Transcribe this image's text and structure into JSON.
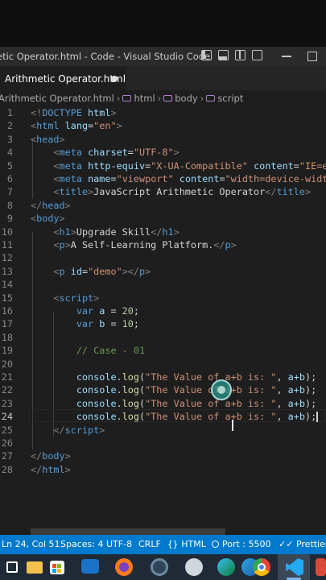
{
  "window": {
    "title": "etic Operator.html - Code - Visual Studio Code"
  },
  "tab": {
    "label": "Arithmetic Operator.html"
  },
  "breadcrumb": {
    "file": "Arithmetic Operator.html",
    "items": [
      "html",
      "body",
      "script"
    ]
  },
  "editor": {
    "lines": [
      "1",
      "2",
      "3",
      "4",
      "5",
      "6",
      "7",
      "8",
      "9",
      "10",
      "11",
      "12",
      "13",
      "14",
      "15",
      "16",
      "17",
      "18",
      "19",
      "20",
      "21",
      "22",
      "23",
      "24",
      "25",
      "26",
      "27",
      "28"
    ],
    "active_line": "24"
  },
  "code": {
    "doctype": "DOCTYPE",
    "doctype_html": "html",
    "html_tag": "html",
    "lang_attr": "lang",
    "lang_val": "\"en\"",
    "head_tag": "head",
    "meta": "meta",
    "charset_attr": "charset",
    "charset_val": "\"UTF-8\"",
    "http_equiv_attr": "http-equiv",
    "http_equiv_val": "\"X-UA-Compatible\"",
    "content_attr": "content",
    "content_val_1": "\"IE=edg",
    "name_attr": "name",
    "name_val": "\"viewport\"",
    "content_val_2": "\"width=device-width",
    "title_tag": "title",
    "title_text": "JavaScript Arithmetic Operator",
    "body_tag": "body",
    "h1_tag": "h1",
    "h1_text": "Upgrade Skill",
    "p_tag": "p",
    "p_text": "A Self-Learning Platform.",
    "id_attr": "id",
    "id_val": "\"demo\"",
    "script_tag": "script",
    "var_kw": "var",
    "var_a": "a",
    "var_b": "b",
    "num_a": "20",
    "num_b": "10",
    "comment": "// Case - 01",
    "console": "console",
    "log": "log",
    "log_str": "\"The Value of a+b is: \"",
    "log_arg": "a+b"
  },
  "statusbar": {
    "position": "Ln 24, Col 51",
    "spaces": "Spaces: 4",
    "encoding": "UTF-8",
    "eol": "CRLF",
    "language": "HTML",
    "port": "Port : 5500",
    "prettier": "Prettier"
  },
  "colors": {
    "accent": "#007acc",
    "editor_bg": "#1e1e1e",
    "tag": "#569cd6",
    "attr": "#9cdcfe",
    "string": "#ce9178",
    "number": "#b5cea8",
    "comment": "#6a9955",
    "function": "#dcdcaa"
  },
  "taskbar": {
    "icons": [
      "windows-start-icon",
      "widgets-icon",
      "store-icon",
      "mail-icon",
      "firefox-icon",
      "settings-icon",
      "edge-icon",
      "edge-alt-icon",
      "chrome-icon",
      "vscode-icon",
      "app-icon"
    ]
  }
}
